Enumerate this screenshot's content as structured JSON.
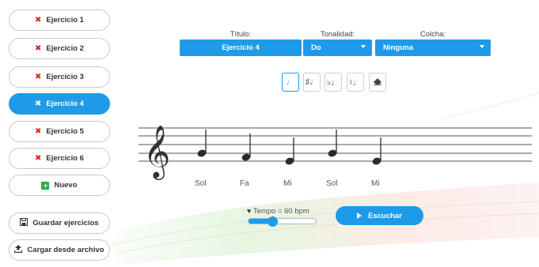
{
  "sidebar": {
    "exercises": [
      {
        "label": "Ejercicio 1",
        "active": false
      },
      {
        "label": "Ejercicio 2",
        "active": false
      },
      {
        "label": "Ejercicio 3",
        "active": false
      },
      {
        "label": "Ejercicio 4",
        "active": true
      },
      {
        "label": "Ejercicio 5",
        "active": false
      },
      {
        "label": "Ejercicio 6",
        "active": false
      }
    ],
    "new_label": "Nuevo",
    "save_label": "Guardar ejercicios",
    "load_label": "Cargar desde archivo"
  },
  "header": {
    "title_label": "Título:",
    "title_value": "Ejercicio 4",
    "key_label": "Tonalidad:",
    "key_value": "Do",
    "rest_label": "Colcha:",
    "rest_value": "Ninguna"
  },
  "tools": [
    {
      "icon": "quarter-note-icon",
      "glyph": "♩",
      "active": true
    },
    {
      "icon": "sharp-note-icon",
      "glyph": "♯♩",
      "active": false
    },
    {
      "icon": "flat-note-icon",
      "glyph": "♭♩",
      "active": false
    },
    {
      "icon": "natural-note-icon",
      "glyph": "♮♩",
      "active": false
    },
    {
      "icon": "eraser-icon",
      "glyph": "",
      "active": false
    }
  ],
  "notes": [
    "Sol",
    "Fa",
    "Mi",
    "Sol",
    "Mi"
  ],
  "tempo": {
    "label": "Tempo = 60 bpm",
    "value": 60,
    "slider_fraction": 0.35
  },
  "play_label": "Escuchar",
  "colors": {
    "accent": "#1e9be8",
    "delete": "#d9262c",
    "add": "#2fa84f"
  }
}
